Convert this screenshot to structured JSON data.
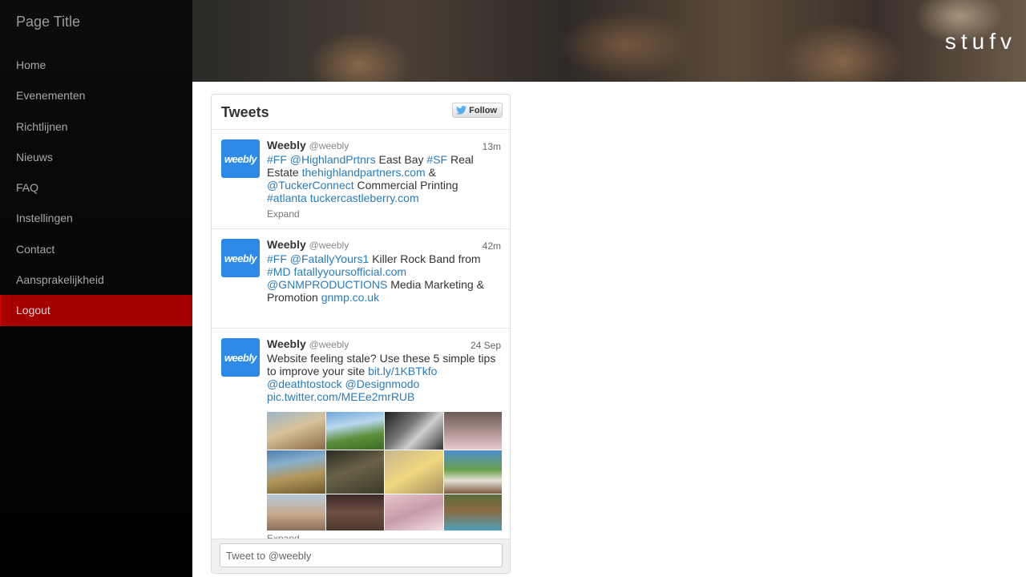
{
  "sidebar": {
    "title": "Page Title",
    "items": [
      {
        "label": "Home"
      },
      {
        "label": "Evenementen"
      },
      {
        "label": "Richtlijnen"
      },
      {
        "label": "Nieuws"
      },
      {
        "label": "FAQ"
      },
      {
        "label": "Instellingen"
      },
      {
        "label": "Contact"
      },
      {
        "label": "Aansprakelijkheid"
      },
      {
        "label": "Logout"
      }
    ],
    "active_color": "#a60000"
  },
  "header": {
    "brand": "stufv"
  },
  "widget": {
    "title": "Tweets",
    "follow_label": "Follow",
    "avatar_text": "weebly",
    "tweet_placeholder": "Tweet to @weebly",
    "expand_label": "Expand",
    "link_color": "#2b7bb9",
    "tweets": [
      {
        "name": "Weebly",
        "handle": "@weebly",
        "time": "13m",
        "parts": {
          "p1": "#FF",
          "p2": "@HighlandPrtnrs",
          "p3": " East Bay ",
          "p4": "#SF",
          "p5": " Real Estate ",
          "p6": "thehighlandpartners.com",
          "p7": " & ",
          "p8": "@TuckerConnect",
          "p9": " Commercial Printing ",
          "p10": "#atlanta",
          "p11": "tuckercastleberry.com"
        }
      },
      {
        "name": "Weebly",
        "handle": "@weebly",
        "time": "42m",
        "parts": {
          "p1": "#FF",
          "p2": "@FatallyYours1",
          "p3": " Killer Rock Band from ",
          "p4": "#MD",
          "p5": "fatallyyoursofficial.com",
          "p6": "@GNMPRODUCTIONS",
          "p7": " Media Marketing & Promotion ",
          "p8": "gnmp.co.uk"
        }
      },
      {
        "name": "Weebly",
        "handle": "@weebly",
        "time": "24 Sep",
        "parts": {
          "p1": "Website feeling stale? Use these 5 simple tips to improve your site ",
          "p2": "bit.ly/1KBTkfo",
          "p3": "@deathtostock",
          "p4": "@Designmodo",
          "p5": "pic.twitter.com/MEEe2mrRUB"
        }
      }
    ]
  },
  "icons": {
    "follow": "twitter-bird-icon"
  }
}
